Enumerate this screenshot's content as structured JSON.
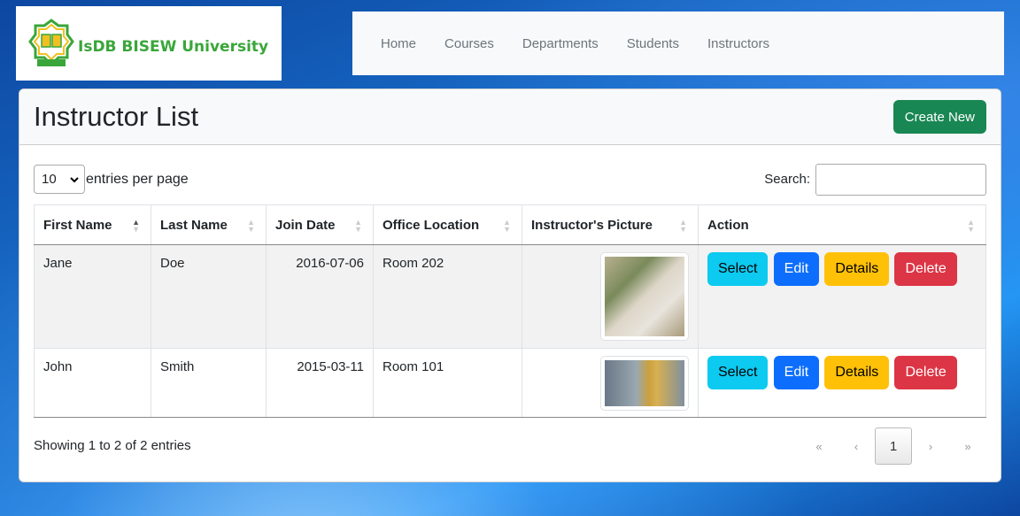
{
  "logo": {
    "text": "IsDB BISEW University",
    "emblem_text": "IsDB-BISEW"
  },
  "nav": {
    "items": [
      "Home",
      "Courses",
      "Departments",
      "Students",
      "Instructors"
    ]
  },
  "page": {
    "title": "Instructor List",
    "create_label": "Create New"
  },
  "controls": {
    "per_page_value": "10",
    "per_page_label": "entries per page",
    "search_label": "Search:"
  },
  "table": {
    "headers": [
      "First Name",
      "Last Name",
      "Join Date",
      "Office Location",
      "Instructor's Picture",
      "Action"
    ],
    "rows": [
      {
        "first": "Jane",
        "last": "Doe",
        "join": "2016-07-06",
        "office": "Room 202"
      },
      {
        "first": "John",
        "last": "Smith",
        "join": "2015-03-11",
        "office": "Room 101"
      }
    ],
    "actions": {
      "select": "Select",
      "edit": "Edit",
      "details": "Details",
      "delete": "Delete"
    }
  },
  "footer": {
    "info": "Showing 1 to 2 of 2 entries"
  },
  "pagination": {
    "first": "«",
    "prev": "‹",
    "current": "1",
    "next": "›",
    "last": "»"
  },
  "colors": {
    "success": "#198754",
    "info": "#0dcaf0",
    "primary": "#0d6efd",
    "warning": "#ffc107",
    "danger": "#dc3545"
  }
}
